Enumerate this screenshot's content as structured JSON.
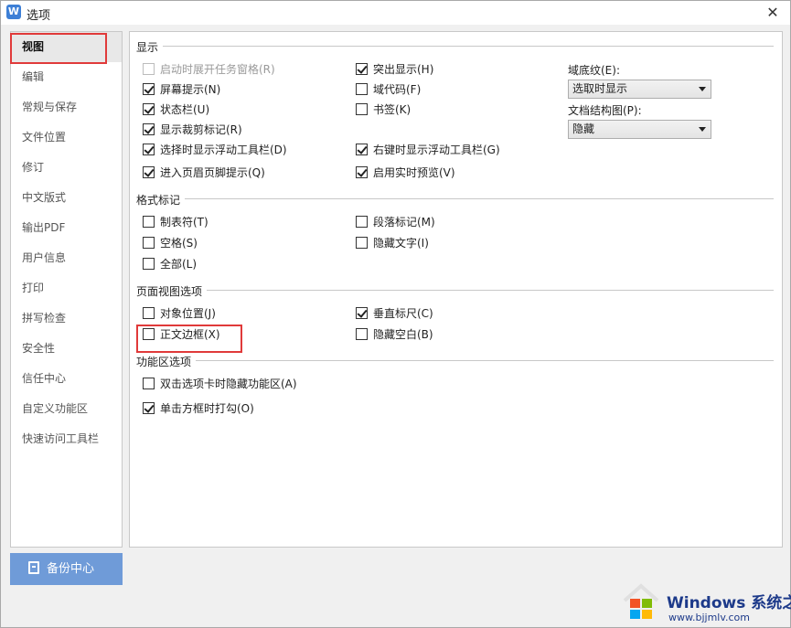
{
  "window": {
    "title": "选项",
    "app_icon": "W"
  },
  "sidebar": {
    "items": [
      {
        "label": "视图",
        "active": true
      },
      {
        "label": "编辑"
      },
      {
        "label": "常规与保存"
      },
      {
        "label": "文件位置"
      },
      {
        "label": "修订"
      },
      {
        "label": "中文版式"
      },
      {
        "label": "输出PDF"
      },
      {
        "label": "用户信息"
      },
      {
        "label": "打印"
      },
      {
        "label": "拼写检查"
      },
      {
        "label": "安全性"
      },
      {
        "label": "信任中心"
      },
      {
        "label": "自定义功能区"
      },
      {
        "label": "快速访问工具栏"
      }
    ],
    "backup_label": "备份中心"
  },
  "display": {
    "title": "显示",
    "left": [
      {
        "label": "启动时展开任务窗格(R)",
        "checked": false,
        "disabled": true
      },
      {
        "label": "屏幕提示(N)",
        "checked": true
      },
      {
        "label": "状态栏(U)",
        "checked": true
      },
      {
        "label": "显示裁剪标记(R)",
        "checked": true
      },
      {
        "label": "选择时显示浮动工具栏(D)",
        "checked": true
      },
      {
        "label": "进入页眉页脚提示(Q)",
        "checked": true
      }
    ],
    "middle": [
      {
        "label": "突出显示(H)",
        "checked": true
      },
      {
        "label": "域代码(F)",
        "checked": false
      },
      {
        "label": "书签(K)",
        "checked": false
      },
      {
        "label": "右键时显示浮动工具栏(G)",
        "checked": true
      },
      {
        "label": "启用实时预览(V)",
        "checked": true
      }
    ],
    "field_shading_label": "域底纹(E):",
    "field_shading_value": "选取时显示",
    "doc_map_label": "文档结构图(P):",
    "doc_map_value": "隐藏"
  },
  "format_marks": {
    "title": "格式标记",
    "items": [
      {
        "label": "制表符(T)",
        "checked": false
      },
      {
        "label": "段落标记(M)",
        "checked": false
      },
      {
        "label": "空格(S)",
        "checked": false
      },
      {
        "label": "隐藏文字(I)",
        "checked": false
      },
      {
        "label": "全部(L)",
        "checked": false
      }
    ]
  },
  "page_view": {
    "title": "页面视图选项",
    "items": [
      {
        "label": "对象位置(J)",
        "checked": false
      },
      {
        "label": "垂直标尺(C)",
        "checked": true
      },
      {
        "label": "正文边框(X)",
        "checked": false
      },
      {
        "label": "隐藏空白(B)",
        "checked": false
      }
    ]
  },
  "ribbon": {
    "title": "功能区选项",
    "items": [
      {
        "label": "双击选项卡时隐藏功能区(A)",
        "checked": false
      },
      {
        "label": "单击方框时打勾(O)",
        "checked": true
      }
    ]
  },
  "watermark": {
    "title": "Windows 系统之家",
    "url": "www.bjjmlv.com"
  },
  "colors": {
    "accent": "#6f9bd8",
    "highlight": "#e03a3a"
  }
}
